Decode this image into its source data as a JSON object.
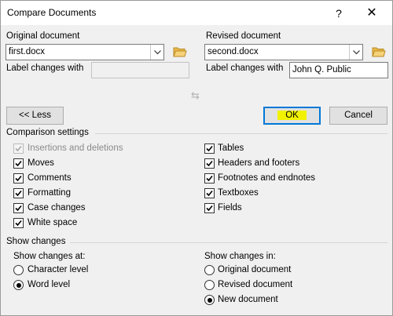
{
  "window": {
    "title": "Compare Documents",
    "help": "?",
    "close": "✕"
  },
  "original": {
    "label": "Original document",
    "file": "first.docx",
    "label_changes_with": "Label changes with",
    "label_value": ""
  },
  "revised": {
    "label": "Revised document",
    "file": "second.docx",
    "label_changes_with": "Label changes with",
    "label_value": "John Q. Public"
  },
  "buttons": {
    "less": "<< Less",
    "ok": "OK",
    "cancel": "Cancel"
  },
  "comparison": {
    "heading": "Comparison settings",
    "left": [
      {
        "label": "Insertions and deletions",
        "checked": true,
        "disabled": true
      },
      {
        "label": "Moves",
        "checked": true,
        "disabled": false
      },
      {
        "label": "Comments",
        "checked": true,
        "disabled": false
      },
      {
        "label": "Formatting",
        "checked": true,
        "disabled": false
      },
      {
        "label": "Case changes",
        "checked": true,
        "disabled": false
      },
      {
        "label": "White space",
        "checked": true,
        "disabled": false
      }
    ],
    "right": [
      {
        "label": "Tables",
        "checked": true
      },
      {
        "label": "Headers and footers",
        "checked": true
      },
      {
        "label": "Footnotes and endnotes",
        "checked": true
      },
      {
        "label": "Textboxes",
        "checked": true
      },
      {
        "label": "Fields",
        "checked": true
      }
    ]
  },
  "show_changes": {
    "heading": "Show changes",
    "at_label": "Show changes at:",
    "at_options": [
      {
        "label": "Character level",
        "selected": false
      },
      {
        "label": "Word level",
        "selected": true
      }
    ],
    "in_label": "Show changes in:",
    "in_options": [
      {
        "label": "Original document",
        "selected": false
      },
      {
        "label": "Revised document",
        "selected": false
      },
      {
        "label": "New document",
        "selected": true
      }
    ]
  },
  "colors": {
    "highlight": "#f2f200",
    "dialog_bg": "#f0f0f0",
    "focus": "#0078d7"
  }
}
